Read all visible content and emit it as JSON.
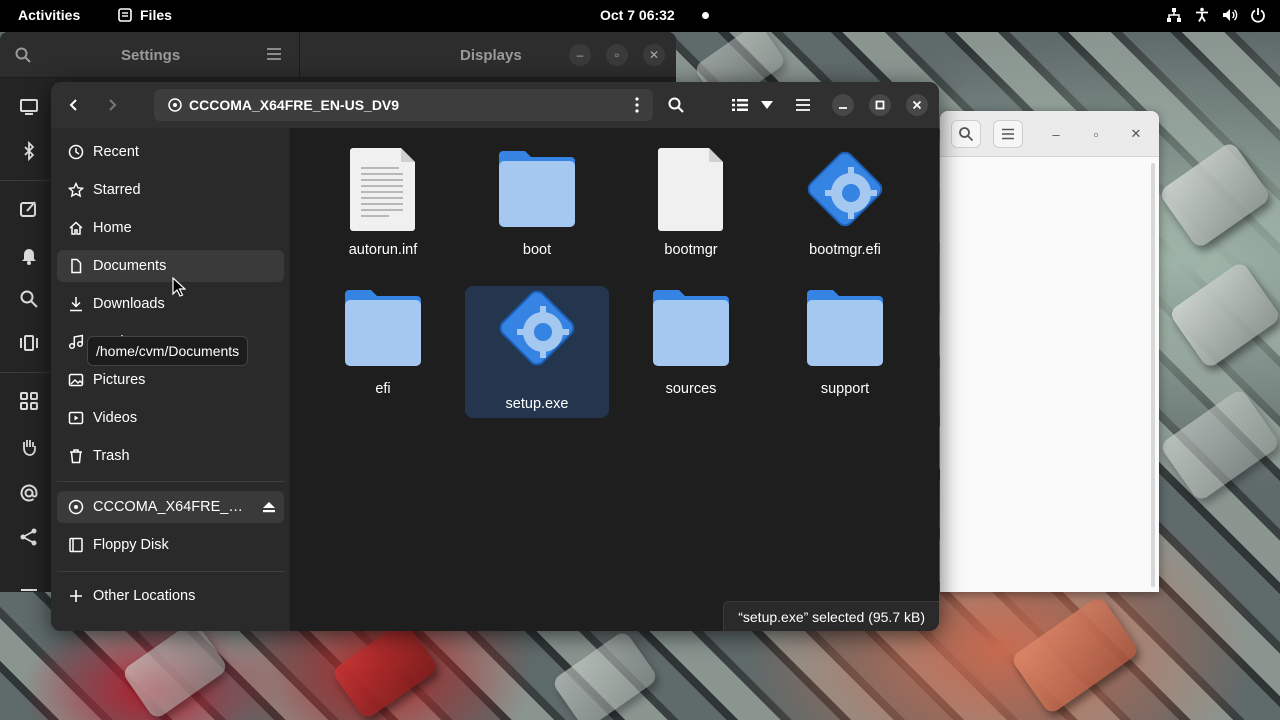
{
  "topbar": {
    "activities": "Activities",
    "app_name": "Files",
    "clock": "Oct 7  06:32"
  },
  "settings": {
    "sidebar_title": "Settings",
    "panel_title": "Displays"
  },
  "files": {
    "path_label": "CCCOMA_X64FRE_EN-US_DV9",
    "sidebar": {
      "items": [
        {
          "label": "Recent",
          "icon": "clock-icon"
        },
        {
          "label": "Starred",
          "icon": "star-icon"
        },
        {
          "label": "Home",
          "icon": "home-icon"
        },
        {
          "label": "Documents",
          "icon": "document-icon"
        },
        {
          "label": "Downloads",
          "icon": "download-icon"
        },
        {
          "label": "Music",
          "icon": "music-icon"
        },
        {
          "label": "Pictures",
          "icon": "picture-icon"
        },
        {
          "label": "Videos",
          "icon": "video-icon"
        },
        {
          "label": "Trash",
          "icon": "trash-icon"
        }
      ],
      "devices": [
        {
          "label": "CCCOMA_X64FRE_…",
          "icon": "disc-icon"
        },
        {
          "label": "Floppy Disk",
          "icon": "floppy-icon"
        }
      ],
      "other_locations": "Other Locations",
      "tooltip": "/home/cvm/Documents"
    },
    "items": [
      {
        "name": "autorun.inf",
        "type": "text"
      },
      {
        "name": "boot",
        "type": "folder"
      },
      {
        "name": "bootmgr",
        "type": "file"
      },
      {
        "name": "bootmgr.efi",
        "type": "exec"
      },
      {
        "name": "efi",
        "type": "folder"
      },
      {
        "name": "setup.exe",
        "type": "exec",
        "selected": true
      },
      {
        "name": "sources",
        "type": "folder"
      },
      {
        "name": "support",
        "type": "folder"
      }
    ],
    "status": "“setup.exe” selected  (95.7 kB)"
  },
  "colors": {
    "accent": "#3584e4",
    "folder_light": "#a4c8f0",
    "selected_bg": "#24364d"
  }
}
